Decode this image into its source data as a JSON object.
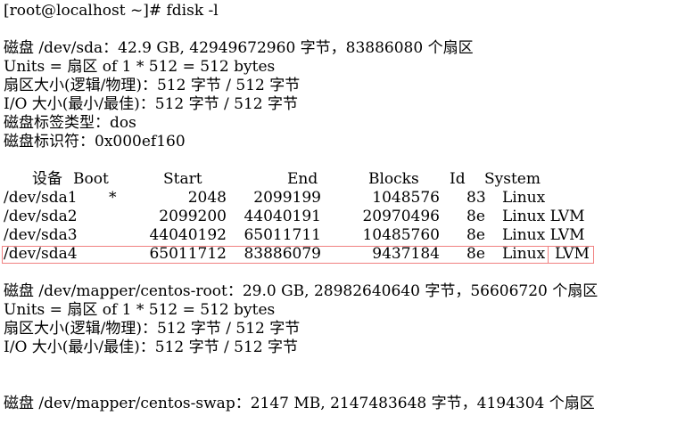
{
  "terminal": {
    "prompt": "[root@localhost ~]# fdisk -l",
    "disk1": {
      "summary": "磁盘 /dev/sda：42.9 GB, 42949672960 字节，83886080 个扇区",
      "units": "Units = 扇区 of 1 * 512 = 512 bytes",
      "sector_size": "扇区大小(逻辑/物理)：512 字节 / 512 字节",
      "io_size": "I/O 大小(最小/最佳)：512 字节 / 512 字节",
      "label_type": "磁盘标签类型：dos",
      "identifier": "磁盘标识符：0x000ef160"
    },
    "partition_table": {
      "headers": {
        "device": "设备",
        "boot": "Boot",
        "start": "Start",
        "end": "End",
        "blocks": "Blocks",
        "id": "Id",
        "system": "System"
      },
      "rows": [
        {
          "device": "/dev/sda1",
          "boot": "*",
          "start": "2048",
          "end": "2099199",
          "blocks": "1048576",
          "id": "83",
          "system": "Linux"
        },
        {
          "device": "/dev/sda2",
          "boot": "",
          "start": "2099200",
          "end": "44040191",
          "blocks": "20970496",
          "id": "8e",
          "system": "Linux LVM"
        },
        {
          "device": "/dev/sda3",
          "boot": "",
          "start": "44040192",
          "end": "65011711",
          "blocks": "10485760",
          "id": "8e",
          "system": "Linux LVM"
        },
        {
          "device": "/dev/sda4",
          "boot": "",
          "start": "65011712",
          "end": "83886079",
          "blocks": "9437184",
          "id": "8e",
          "system": "Linux",
          "system2": "LVM"
        }
      ]
    },
    "disk2": {
      "summary": "磁盘 /dev/mapper/centos-root：29.0 GB, 28982640640 字节，56606720 个扇区",
      "units": "Units = 扇区 of 1 * 512 = 512 bytes",
      "sector_size": "扇区大小(逻辑/物理)：512 字节 / 512 字节",
      "io_size": "I/O 大小(最小/最佳)：512 字节 / 512 字节"
    },
    "disk3": {
      "summary": "磁盘 /dev/mapper/centos-swap：2147 MB, 2147483648 字节，4194304 个扇区"
    },
    "highlight_color": "#f08080"
  }
}
